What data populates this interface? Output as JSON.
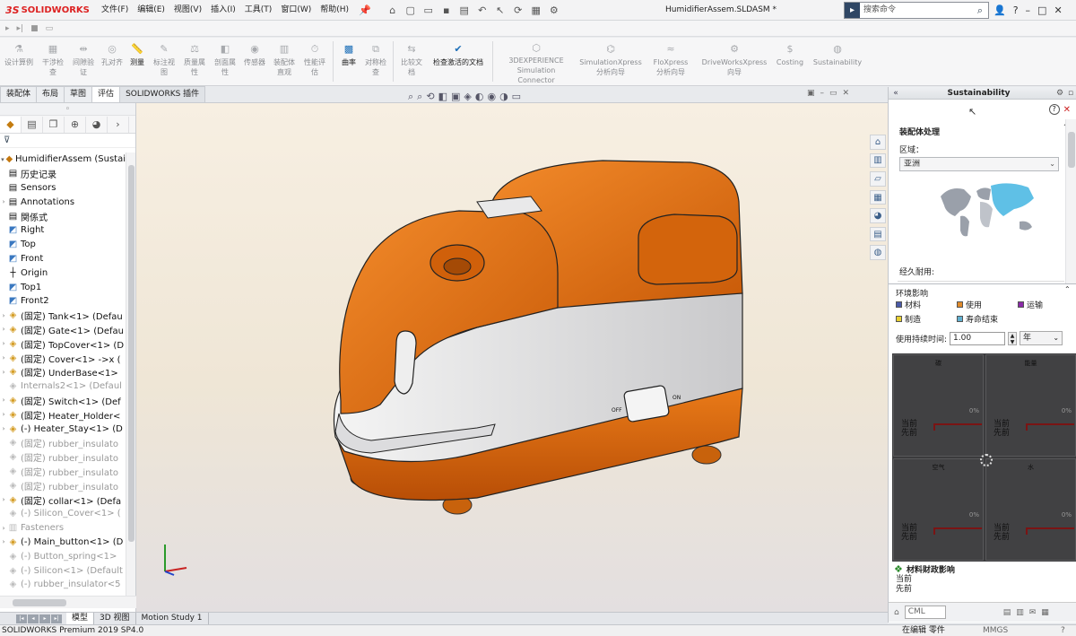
{
  "app": {
    "logo": "SOLIDWORKS",
    "logo_prefix": "3S",
    "document_title": "HumidifierAssem.SLDASM *"
  },
  "menu": [
    "文件(F)",
    "编辑(E)",
    "视图(V)",
    "插入(I)",
    "工具(T)",
    "窗口(W)",
    "帮助(H)"
  ],
  "search": {
    "placeholder": "搜索命令"
  },
  "window_controls": [
    "?",
    "–",
    "□",
    "✕"
  ],
  "ribbon": [
    {
      "label": "设计算例",
      "icon": "study-icon",
      "active": false
    },
    {
      "label": "干涉检\n查",
      "icon": "interference-icon",
      "active": false
    },
    {
      "label": "间隙验\n证",
      "icon": "clearance-icon",
      "active": false
    },
    {
      "label": "孔对齐",
      "icon": "hole-align-icon",
      "active": false
    },
    {
      "label": "测量",
      "icon": "measure-icon",
      "active": true
    },
    {
      "label": "标注视\n图",
      "icon": "markup-icon",
      "active": false
    },
    {
      "label": "质量属\n性",
      "icon": "mass-icon",
      "active": false
    },
    {
      "label": "剖面属\n性",
      "icon": "section-icon",
      "active": false
    },
    {
      "label": "传感器",
      "icon": "sensor-icon",
      "active": false
    },
    {
      "label": "装配体\n直观",
      "icon": "visualization-icon",
      "active": false
    },
    {
      "label": "性能评\n估",
      "icon": "performance-icon",
      "active": false
    },
    {
      "label": "曲率",
      "icon": "curvature-icon",
      "active": true
    },
    {
      "label": "对称检\n查",
      "icon": "symmetry-icon",
      "active": false
    },
    {
      "label": "比较文\n档",
      "icon": "compare-icon",
      "active": false
    },
    {
      "label": "检查激活的文档",
      "icon": "check-doc-icon",
      "active": true
    },
    {
      "label": "3DEXPERIENCE\nSimulation Connector",
      "icon": "3dx-icon",
      "active": false
    },
    {
      "label": "SimulationXpress\n分析向导",
      "icon": "simxpress-icon",
      "active": false
    },
    {
      "label": "FloXpress\n分析向导",
      "icon": "floxpress-icon",
      "active": false
    },
    {
      "label": "DriveWorksXpress\n向导",
      "icon": "driveworks-icon",
      "active": false
    },
    {
      "label": "Costing",
      "icon": "costing-icon",
      "active": false
    },
    {
      "label": "Sustainability",
      "icon": "sustainability-icon",
      "active": false
    }
  ],
  "cm_tabs": [
    {
      "label": "装配体",
      "selected": false
    },
    {
      "label": "布局",
      "selected": false
    },
    {
      "label": "草图",
      "selected": false
    },
    {
      "label": "评估",
      "selected": true
    },
    {
      "label": "SOLIDWORKS 插件",
      "selected": false
    }
  ],
  "tree": [
    {
      "label": "HumidifierAssem  (Sustai",
      "kind": "root",
      "toggle": "▾"
    },
    {
      "label": "历史记录",
      "kind": "folder",
      "toggle": ""
    },
    {
      "label": "Sensors",
      "kind": "folder",
      "toggle": ""
    },
    {
      "label": "Annotations",
      "kind": "folder",
      "toggle": "›"
    },
    {
      "label": "関係式",
      "kind": "folder",
      "toggle": ""
    },
    {
      "label": "Right",
      "kind": "plane",
      "toggle": ""
    },
    {
      "label": "Top",
      "kind": "plane",
      "toggle": ""
    },
    {
      "label": "Front",
      "kind": "plane",
      "toggle": ""
    },
    {
      "label": "Origin",
      "kind": "origin",
      "toggle": ""
    },
    {
      "label": "Top1",
      "kind": "plane",
      "toggle": ""
    },
    {
      "label": "Front2",
      "kind": "plane",
      "toggle": ""
    },
    {
      "label": "(固定) Tank<1> (Defau",
      "kind": "part",
      "toggle": "›"
    },
    {
      "label": "(固定) Gate<1> (Defau",
      "kind": "part",
      "toggle": "›"
    },
    {
      "label": "(固定) TopCover<1> (D",
      "kind": "part",
      "toggle": "›"
    },
    {
      "label": "(固定) Cover<1> ->x (",
      "kind": "part",
      "toggle": "›"
    },
    {
      "label": "(固定) UnderBase<1>",
      "kind": "part",
      "toggle": "›"
    },
    {
      "label": "Internals2<1> (Defaul",
      "kind": "grey",
      "toggle": ""
    },
    {
      "label": "(固定) Switch<1> (Def",
      "kind": "part",
      "toggle": "›"
    },
    {
      "label": "(固定) Heater_Holder<",
      "kind": "part",
      "toggle": "›"
    },
    {
      "label": "(-) Heater_Stay<1> (D",
      "kind": "part",
      "toggle": "›"
    },
    {
      "label": "(固定) rubber_insulato",
      "kind": "grey",
      "toggle": ""
    },
    {
      "label": "(固定) rubber_insulato",
      "kind": "grey",
      "toggle": ""
    },
    {
      "label": "(固定) rubber_insulato",
      "kind": "grey",
      "toggle": ""
    },
    {
      "label": "(固定) rubber_insulato",
      "kind": "grey",
      "toggle": ""
    },
    {
      "label": "(固定) collar<1> (Defa",
      "kind": "part",
      "toggle": "›"
    },
    {
      "label": "(-) Silicon_Cover<1> (",
      "kind": "grey",
      "toggle": ""
    },
    {
      "label": "Fasteners",
      "kind": "greyfolder",
      "toggle": "›"
    },
    {
      "label": "(-) Main_button<1> (D",
      "kind": "part",
      "toggle": "›"
    },
    {
      "label": "(-) Button_spring<1>",
      "kind": "grey",
      "toggle": ""
    },
    {
      "label": "(-) Silicon<1> (Default",
      "kind": "grey",
      "toggle": ""
    },
    {
      "label": "(-) rubber_insulator<5",
      "kind": "grey",
      "toggle": ""
    }
  ],
  "model": {
    "switch_off": "OFF",
    "switch_on": "ON"
  },
  "sustainability": {
    "title": "Sustainability",
    "section": "装配体处理",
    "region_label": "区域：",
    "region_value": "亚洲",
    "durability_label": "经久耐用:",
    "env_title": "环境影响",
    "legend": [
      {
        "label": "材料",
        "color": "#4a5aa8"
      },
      {
        "label": "使用",
        "color": "#e08a2a"
      },
      {
        "label": "运输",
        "color": "#8a2aa8"
      },
      {
        "label": "制造",
        "color": "#e8d030"
      },
      {
        "label": "寿命结束",
        "color": "#60b0d0"
      }
    ],
    "use_duration_label": "使用持续时间:",
    "use_duration_value": "1.00",
    "use_duration_unit": "年",
    "quadrants": [
      {
        "title": "碳",
        "pct": "0%",
        "current": "当前",
        "previous": "先前"
      },
      {
        "title": "能量",
        "pct": "0%",
        "current": "当前",
        "previous": "先前"
      },
      {
        "title": "空气",
        "pct": "0%",
        "current": "当前",
        "previous": "先前"
      },
      {
        "title": "水",
        "pct": "0%",
        "current": "当前",
        "previous": "先前"
      }
    ],
    "financial_title": "材料财政影响",
    "financial_current": "当前",
    "financial_previous": "先前",
    "cml_value": "CML"
  },
  "bottom_tabs": [
    {
      "label": "模型",
      "selected": true
    },
    {
      "label": "3D 视图",
      "selected": false
    },
    {
      "label": "Motion Study 1",
      "selected": false
    }
  ],
  "status": {
    "left": "SOLIDWORKS Premium 2019 SP4.0",
    "mode": "在编辑 零件",
    "units": "MMGS",
    "extra": "?"
  }
}
